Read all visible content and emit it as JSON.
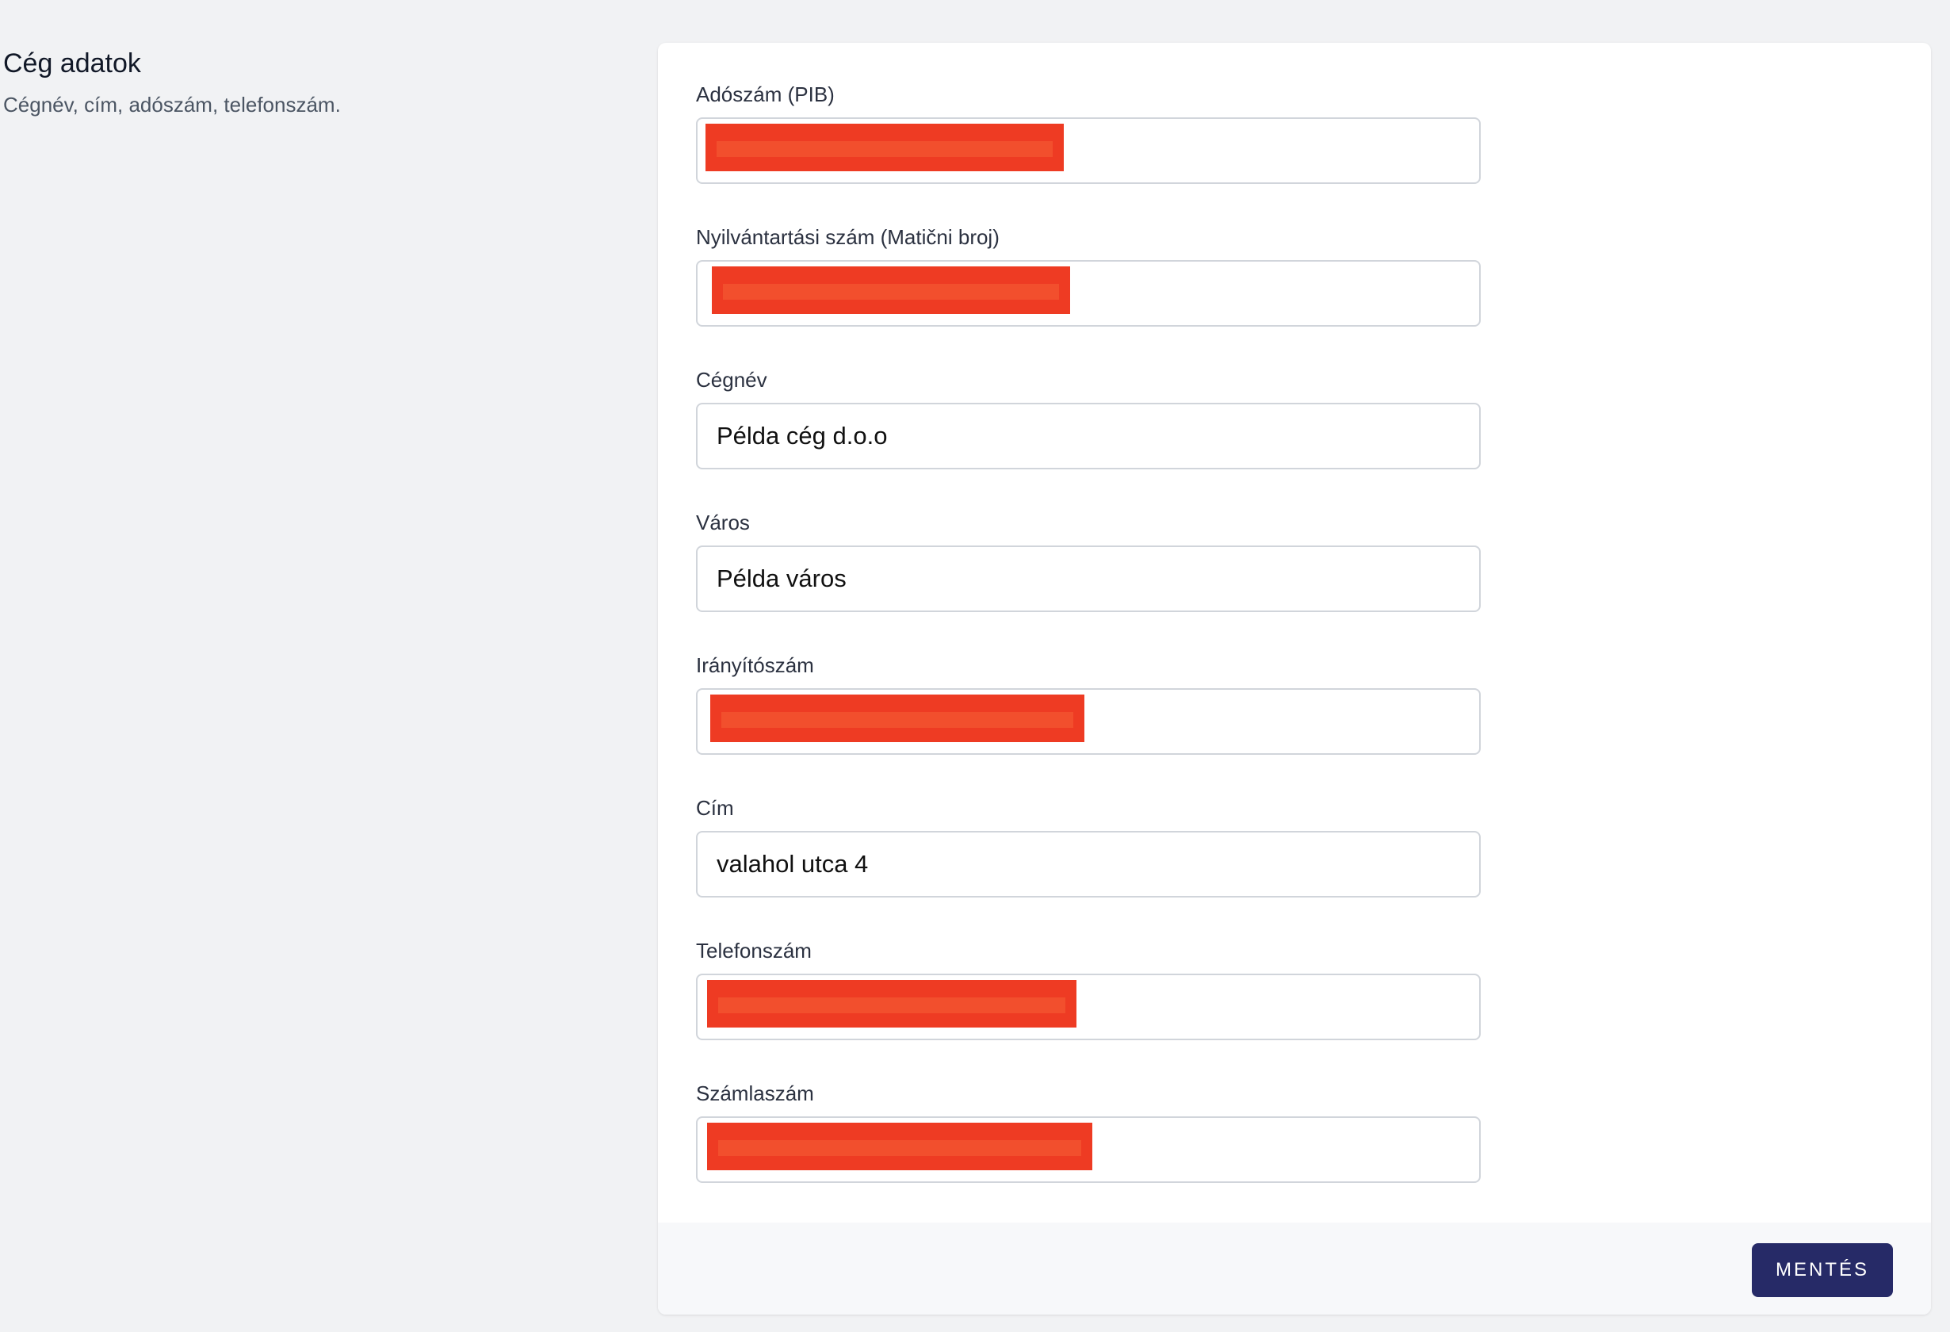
{
  "section": {
    "title": "Cég adatok",
    "description": "Cégnév, cím, adószám, telefonszám."
  },
  "form": {
    "fields": [
      {
        "label": "Adószám (PIB)",
        "value": "",
        "redacted": true
      },
      {
        "label": "Nyilvántartási szám (Matični broj)",
        "value": "",
        "redacted": true
      },
      {
        "label": "Cégnév",
        "value": "Példa cég d.o.o",
        "redacted": false
      },
      {
        "label": "Város",
        "value": "Példa város",
        "redacted": false
      },
      {
        "label": "Irányítószám",
        "value": "",
        "redacted": true
      },
      {
        "label": "Cím",
        "value": "valahol utca 4",
        "redacted": false
      },
      {
        "label": "Telefonszám",
        "value": "",
        "redacted": true
      },
      {
        "label": "Számlaszám",
        "value": "",
        "redacted": true
      }
    ]
  },
  "footer": {
    "save_label": "MENTÉS"
  },
  "colors": {
    "page_background": "#f1f2f4",
    "card_background": "#ffffff",
    "button_background": "#262a67",
    "redaction": "#ee3b23"
  }
}
